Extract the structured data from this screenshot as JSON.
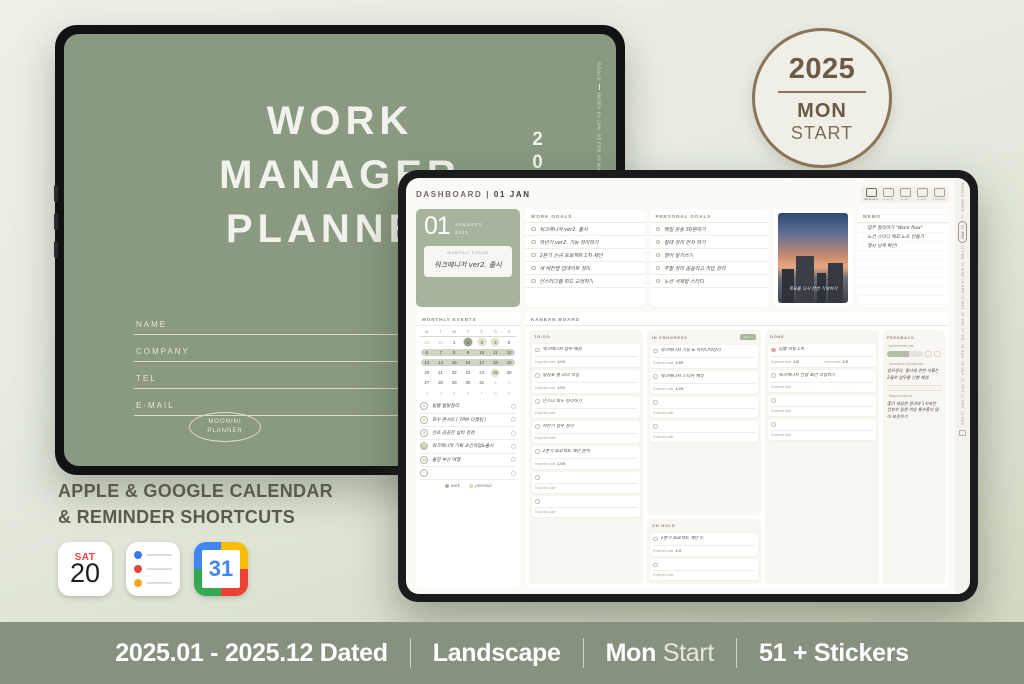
{
  "cover": {
    "title_lines": [
      "WORK",
      "MANAGER",
      "PLANNER"
    ],
    "fields": [
      "NAME",
      "COMPANY",
      "TEL",
      "E-MAIL"
    ],
    "logo_lines": [
      "MOONINI",
      "PLANNER"
    ],
    "year": "2025",
    "side_tabs": [
      "GOALS",
      "INDEX",
      "01 JAN",
      "02 FEB",
      "03 MAR"
    ],
    "bg_color": "#899a80"
  },
  "badge": {
    "year": "2025",
    "month": "MON",
    "start": "START",
    "color": "#8a7559"
  },
  "promo": {
    "line1": "APPLE & GOOGLE CALENDAR",
    "line2": "& REMINDER SHORTCUTS",
    "apps": [
      {
        "name": "apple-calendar",
        "day": "SAT",
        "date": "20"
      },
      {
        "name": "apple-reminders",
        "dots": [
          "#3478f6",
          "#e8453c",
          "#f5a623"
        ]
      },
      {
        "name": "google-calendar",
        "date": "31"
      }
    ]
  },
  "footer": {
    "items": [
      {
        "strong": "2025.01 - 2025.12 Dated",
        "lite": ""
      },
      {
        "strong": "Landscape",
        "lite": ""
      },
      {
        "strong": "Mon ",
        "lite": "Start"
      },
      {
        "strong": "51 + Stickers",
        "lite": ""
      }
    ]
  },
  "dashboard": {
    "title_prefix": "DASHBOARD | ",
    "title_date": "01 JAN",
    "nav": [
      {
        "label": "dashboard",
        "icon": "home-icon"
      },
      {
        "label": "monthly",
        "icon": "calendar-icon"
      },
      {
        "label": "weekly",
        "icon": "checklist-icon"
      },
      {
        "label": "project",
        "icon": "board-icon"
      },
      {
        "label": "notebook",
        "icon": "note-icon"
      }
    ],
    "date_card": {
      "day": "01",
      "month": "JANUARY",
      "year": "2025",
      "focus_label": "MONTHLY FOCUS",
      "focus_text": "워크매니저 ver2. 출시"
    },
    "work_goals": {
      "header": "WORK GOALS",
      "items": [
        "워크매니저 ver2. 출시",
        "하반기 ver2. 기능 정리하기",
        "2분기 신규 프로젝트 1차 제안",
        "새 버전별 업데이트 정리",
        "인스타그램 피드 교정하기"
      ]
    },
    "personal_goals": {
      "header": "PERSONAL GOALS",
      "items": [
        "매일 운동 30분하기",
        "침대 정리 먼저 하기",
        "영어 일기쓰기",
        "주말 정리 꼼꼼하고 작업 정리",
        "노션 서재함 스터디"
      ]
    },
    "photo": {
      "caption": "목표를 다시 한번 기억하기"
    },
    "memo": {
      "header": "MEMO",
      "items": [
        "업무 정리하기 \"Work flow\"",
        "노션 스터디 메모 노트 만들기",
        "행사 날짜 확인!"
      ]
    },
    "calendar": {
      "header": "MONTHLY EVENTS",
      "weekdays": [
        "M",
        "T",
        "W",
        "T",
        "F",
        "S",
        "S"
      ],
      "weeks": [
        {
          "days": [
            "30",
            "31",
            "1",
            "2",
            "3",
            "4",
            "5"
          ],
          "muted": [
            0,
            1
          ],
          "green": [
            3
          ],
          "yellow": [
            4,
            5
          ],
          "bar": false
        },
        {
          "days": [
            "6",
            "7",
            "8",
            "9",
            "10",
            "11",
            "12"
          ],
          "muted": [],
          "green": [],
          "yellow": [],
          "bar": true
        },
        {
          "days": [
            "13",
            "14",
            "15",
            "16",
            "17",
            "18",
            "19"
          ],
          "muted": [],
          "green": [],
          "yellow": [],
          "bar": true
        },
        {
          "days": [
            "20",
            "21",
            "22",
            "23",
            "24",
            "25",
            "26"
          ],
          "muted": [],
          "green": [],
          "yellow": [
            5
          ],
          "bar": false
        },
        {
          "days": [
            "27",
            "28",
            "29",
            "30",
            "31",
            "1",
            "2"
          ],
          "muted": [
            5,
            6
          ],
          "green": [],
          "yellow": [],
          "bar": false
        },
        {
          "days": [
            "3",
            "4",
            "5",
            "6",
            "7",
            "8",
            "9"
          ],
          "muted": [
            0,
            1,
            2,
            3,
            4,
            5,
            6
          ],
          "green": [],
          "yellow": [],
          "bar": false
        }
      ],
      "events": [
        {
          "badge": "1",
          "fill": false,
          "text": "팀별 월말정리"
        },
        {
          "badge": "2",
          "fill": false,
          "text": "화우 콘서트 ( 7PM 티켓팅 )"
        },
        {
          "badge": "3",
          "fill": false,
          "text": "연초 꼼꼼한 실비 점검"
        },
        {
          "badge": "기획\n미팅",
          "fill": true,
          "text": "워크매니저 기획 초안작업&출시"
        },
        {
          "badge": "14",
          "fill": false,
          "text": "출장 부산 여행"
        },
        {
          "badge": "",
          "fill": false,
          "text": ""
        }
      ],
      "legend": [
        {
          "label": "work",
          "color": "#a7b49c"
        },
        {
          "label": "personal",
          "color": "#ddd9a8"
        }
      ]
    },
    "kanban": {
      "header": "KANBAN BOARD",
      "meta_expected": "Expected date",
      "meta_actual": "Actual date",
      "columns": [
        {
          "title": "TO-DO",
          "chip": "",
          "cards": [
            {
              "text": "워크매니저 업무 배정",
              "expected": "1/10",
              "actual": "",
              "done": false
            },
            {
              "text": "일정표 틀 미리 작성",
              "expected": "1/12",
              "actual": "",
              "done": false
            },
            {
              "text": "인스타 피드 정리하기",
              "expected": "",
              "actual": "",
              "done": false
            },
            {
              "text": "하반기 업무 정리",
              "expected": "",
              "actual": "",
              "done": false
            },
            {
              "text": "2분기 프로젝트 제안 준비",
              "expected": "1/18",
              "actual": "",
              "done": false
            },
            {
              "text": "",
              "expected": "",
              "actual": "",
              "done": false
            },
            {
              "text": "",
              "expected": "",
              "actual": "",
              "done": false
            }
          ]
        },
        {
          "title": "IN PROGRESS",
          "chip": "max 3",
          "cards": [
            {
              "text": "워크매니저 기능 & 아이디어정리",
              "expected": "1/09",
              "actual": "",
              "done": false
            },
            {
              "text": "워크매니저 스티커 제작",
              "expected": "1/16",
              "actual": "",
              "done": false
            },
            {
              "text": "",
              "expected": "",
              "actual": "",
              "done": false
            },
            {
              "text": "",
              "expected": "",
              "actual": "",
              "done": false
            }
          ]
        },
        {
          "title": "DONE",
          "chip": "",
          "cards": [
            {
              "text": "팀별 미팅 1차",
              "expected": "1/5",
              "actual": "1/5",
              "done": true
            },
            {
              "text": "워크매니저 컨셉 초안 작업하기",
              "expected": "",
              "actual": "",
              "done": false
            },
            {
              "text": "",
              "expected": "",
              "actual": "",
              "done": false
            },
            {
              "text": "",
              "expected": "",
              "actual": "",
              "done": false
            }
          ]
        }
      ],
      "on_hold": {
        "title": "ON HOLD",
        "cards": [
          {
            "text": "2분기 프로젝트 제안 ①",
            "expected": "1/9",
            "actual": "",
            "done": false
          },
          {
            "text": "",
            "expected": "",
            "actual": "",
            "done": false
          }
        ]
      }
    },
    "feedback": {
      "header": "FEEDBACK",
      "rate_label": "· Achievement rate",
      "rate_percent": 60,
      "incomplete_label": "· Incomplete & postponed",
      "incomplete_text": "업무정리, 출시에 관한 서류는 2월로 업무를 진행 예정.",
      "improve_label": "· Ways to improve",
      "improve_text": "좀더 세심한 정리와 1차초안 전후로 팀원 미팅 횟수들이 많아 보완하기"
    },
    "month_tabs": [
      "GOALS",
      "INDEX",
      "01 JAN",
      "02 FEB",
      "03 MAR",
      "04 APR",
      "05 MAY",
      "06 JUN",
      "07 JUL",
      "08 AUG",
      "09 SEP",
      "10 OCT",
      "11 NOV",
      "12 DEC"
    ],
    "active_month_tab": "01 JAN"
  }
}
